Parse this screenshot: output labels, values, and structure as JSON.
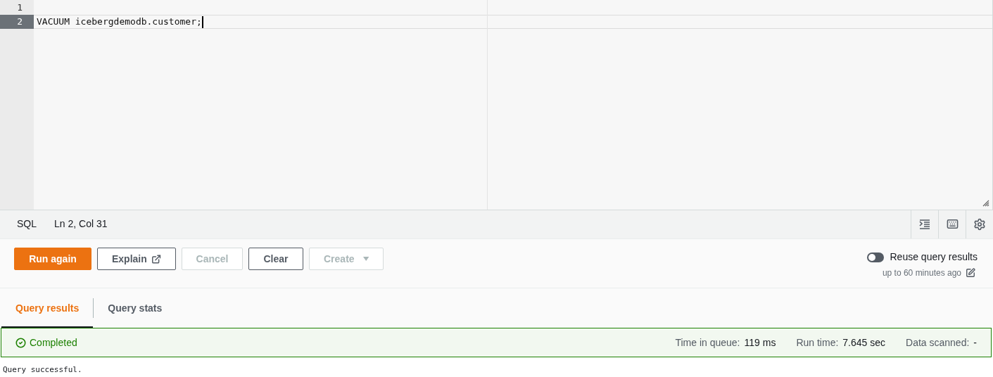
{
  "editor": {
    "lines": [
      {
        "number": "1",
        "selected": false
      },
      {
        "number": "2",
        "text": "VACUUM icebergdemodb.customer;",
        "selected": true
      }
    ]
  },
  "status_bar": {
    "language": "SQL",
    "position": "Ln 2, Col 31"
  },
  "buttons": [
    {
      "label": "Run again",
      "kind": "primary",
      "disabled": false
    },
    {
      "label": "Explain",
      "kind": "external",
      "disabled": false
    },
    {
      "label": "Cancel",
      "kind": "normal",
      "disabled": true
    },
    {
      "label": "Clear",
      "kind": "normal",
      "disabled": false
    },
    {
      "label": "Create",
      "kind": "dropdown",
      "disabled": true
    }
  ],
  "reuse": {
    "label": "Reuse query results",
    "on": false,
    "subtitle": "up to 60 minutes ago"
  },
  "tabs": [
    {
      "label": "Query results",
      "selected": true
    },
    {
      "label": "Query stats",
      "selected": false
    }
  ],
  "status": {
    "label": "Completed",
    "stats": [
      {
        "label": "Time in queue:",
        "value": "119 ms"
      },
      {
        "label": "Run time:",
        "value": "7.645 sec"
      },
      {
        "label": "Data scanned:",
        "value": "-"
      }
    ]
  },
  "result_message": "Query successful."
}
